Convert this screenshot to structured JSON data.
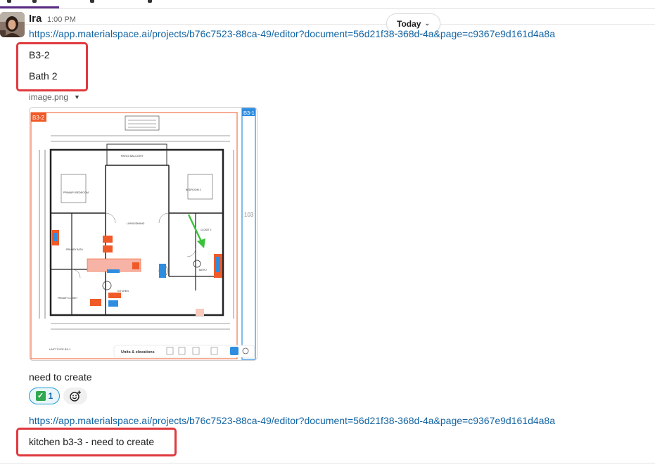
{
  "date_divider": {
    "label": "Today"
  },
  "message1": {
    "sender": "Ira",
    "time": "1:00 PM",
    "link": "https://app.materialspace.ai/projects/b76c7523-88ca-49/editor?document=56d21f38-368d-4a&page=c9367e9d161d4a8a",
    "lines": [
      "B3-2",
      "Bath 2"
    ],
    "image_name": "image.png",
    "plan": {
      "unit_label_left": "B3-2",
      "unit_label_right": "B3-1",
      "side_number": "103",
      "toolbar_label": "Units & elevations",
      "sheet_caption": "UNIT TYPE B3-1",
      "callouts": {
        "living": "LIVING/DINING",
        "primary_bedroom": "PRIMARY BEDROOM",
        "bedroom2": "BEDROOM 2",
        "kitchen": "KITCHEN",
        "primary_bath": "PRIMARY BATH",
        "bath2": "BATH 2",
        "primary_closet": "PRIMARY CLOSET",
        "patio": "PATIO BALCONY",
        "closet2": "CLOSET 2"
      }
    },
    "after_text": "need to create",
    "reactions": [
      {
        "emoji": "white-check-mark",
        "count": "1"
      }
    ]
  },
  "message2": {
    "link": "https://app.materialspace.ai/projects/b76c7523-88ca-49/editor?document=56d21f38-368d-4a&page=c9367e9d161d4a8a",
    "text": "kitchen b3-3 - need to create"
  },
  "colors": {
    "link": "#1264a3",
    "highlight_box": "#e0393e",
    "plan_orange": "#f05a28",
    "plan_blue": "#2f8de0",
    "arrow_green": "#3cc13b"
  }
}
